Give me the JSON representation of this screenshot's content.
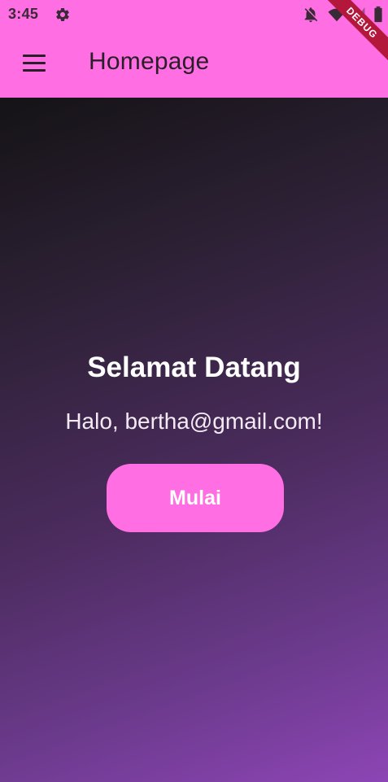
{
  "status_bar": {
    "time": "3:45",
    "icons": [
      "gear-icon",
      "notifications-off-icon",
      "wifi-icon",
      "signal-icon",
      "battery-icon"
    ]
  },
  "app_bar": {
    "title": "Homepage",
    "menu_icon": "menu-icon"
  },
  "debug_banner": {
    "label": "DEBUG"
  },
  "main": {
    "welcome_title": "Selamat Datang",
    "greeting": "Halo, bertha@gmail.com!",
    "start_button_label": "Mulai"
  },
  "colors": {
    "accent": "#ff6ee3",
    "debug_ribbon": "#b3173b",
    "gradient_start": "#151316",
    "gradient_end": "#8d45b5"
  }
}
